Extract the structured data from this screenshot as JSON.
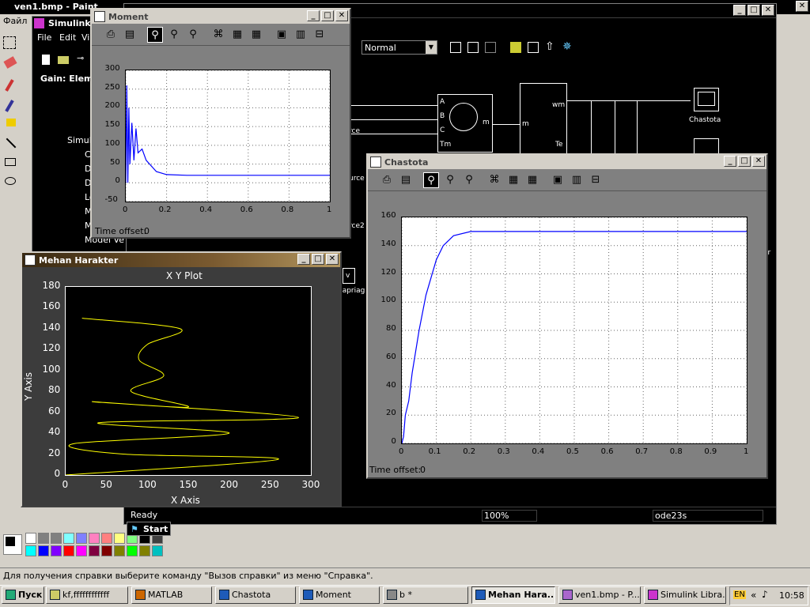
{
  "paint": {
    "title": "ven1.bmp - Paint",
    "menu_file": "Файл",
    "status": "Для получения справки выберите команду \"Вызов справки\" из меню \"Справка\"."
  },
  "simlib": {
    "title": "Simulink",
    "menu": [
      "File",
      "Edit",
      "Vi"
    ],
    "gain_text": "Gain: Eleme",
    "tree_root": "Simuli",
    "tree_items": [
      "C",
      "D",
      "D",
      "Lo",
      "M",
      "M",
      "Model Ve"
    ]
  },
  "model": {
    "mode": "Normal",
    "status_ready": "Ready",
    "zoom": "100%",
    "solver": "ode23s",
    "labels": {
      "wm": "wm",
      "te": "Te",
      "m1": "m",
      "m2": "m",
      "tm": "Tm",
      "a": "A",
      "b": "B",
      "c": "C",
      "chastota": "Chastota",
      "source": "rce",
      "source2": "urce",
      "source3": "rce2",
      "v": "v",
      "napriag": "napriag",
      "right": "er"
    }
  },
  "moment": {
    "title": "Moment",
    "time_offset_label": "Time offset:",
    "time_offset": "0",
    "yticks": [
      "300",
      "250",
      "200",
      "150",
      "100",
      "50",
      "0",
      "-50"
    ],
    "xticks": [
      "0",
      "0.2",
      "0.4",
      "0.6",
      "0.8",
      "1"
    ]
  },
  "chastota": {
    "title": "Chastota",
    "time_offset_label": "Time offset:",
    "time_offset": "0",
    "yticks": [
      "160",
      "140",
      "120",
      "100",
      "80",
      "60",
      "40",
      "20",
      "0"
    ],
    "xticks": [
      "0",
      "0.1",
      "0.2",
      "0.3",
      "0.4",
      "0.5",
      "0.6",
      "0.7",
      "0.8",
      "0.9",
      "1"
    ]
  },
  "xy": {
    "title": "Mehan Harakter",
    "plot_title": "X Y Plot",
    "xlabel": "X Axis",
    "ylabel": "Y Axis",
    "yticks": [
      "180",
      "160",
      "140",
      "120",
      "100",
      "80",
      "60",
      "40",
      "20",
      "0"
    ],
    "xticks": [
      "0",
      "50",
      "100",
      "150",
      "200",
      "250",
      "300"
    ]
  },
  "start_btn": "Start",
  "taskbar": {
    "start": "Пуск",
    "items": [
      "kf,ffffffffffff",
      "MATLAB",
      "Chastota",
      "Moment",
      "b *",
      "Mehan Hara...",
      "ven1.bmp - P...",
      "Simulink Libra..."
    ],
    "lang": "EN",
    "clock": "10:58"
  },
  "chart_data": [
    {
      "type": "line",
      "title": "Moment",
      "x": [
        0,
        0.005,
        0.01,
        0.015,
        0.02,
        0.03,
        0.04,
        0.05,
        0.06,
        0.08,
        0.1,
        0.15,
        0.2,
        0.3,
        0.5,
        1
      ],
      "series": [
        {
          "values": [
            0,
            260,
            0,
            200,
            50,
            160,
            60,
            145,
            80,
            90,
            60,
            30,
            22,
            20,
            20,
            20
          ]
        }
      ],
      "xlim": [
        0,
        1
      ],
      "ylim": [
        -50,
        300
      ],
      "grid": true
    },
    {
      "type": "line",
      "title": "Chastota",
      "x": [
        0,
        0.005,
        0.01,
        0.02,
        0.03,
        0.05,
        0.07,
        0.1,
        0.12,
        0.15,
        0.2,
        0.25,
        0.5,
        1
      ],
      "series": [
        {
          "values": [
            0,
            5,
            20,
            30,
            50,
            80,
            105,
            130,
            140,
            147,
            150,
            150,
            150,
            150
          ]
        }
      ],
      "xlim": [
        0,
        1
      ],
      "ylim": [
        0,
        160
      ],
      "grid": true
    },
    {
      "type": "line",
      "title": "X Y Plot",
      "x": [
        0,
        260,
        70,
        10,
        200,
        40,
        285,
        35,
        150,
        80,
        120,
        90,
        100,
        140,
        20
      ],
      "series": [
        {
          "values": [
            0,
            15,
            20,
            30,
            40,
            50,
            55,
            70,
            65,
            80,
            95,
            110,
            125,
            140,
            150
          ]
        }
      ],
      "xlim": [
        0,
        300
      ],
      "ylim": [
        0,
        180
      ],
      "xlabel": "X Axis",
      "ylabel": "Y Axis"
    }
  ],
  "colors": {
    "desktop": "#000000",
    "win_bg": "#808080",
    "trace_blue": "#0000ff",
    "trace_yellow": "#ffff00",
    "title_active": "#6a4a20"
  }
}
